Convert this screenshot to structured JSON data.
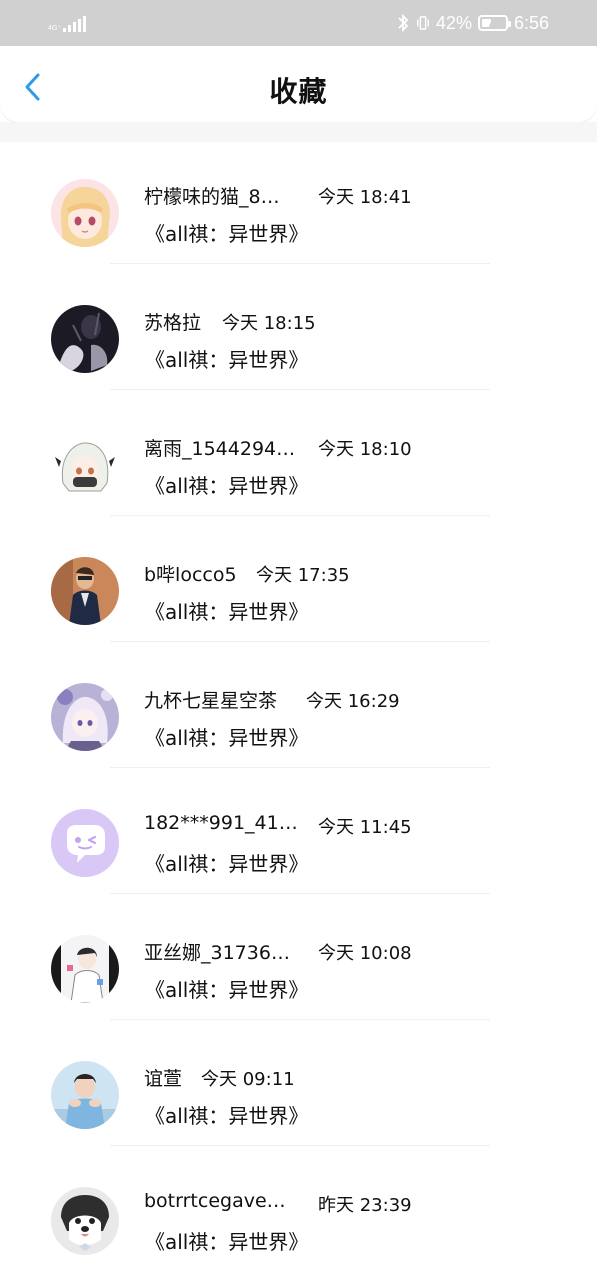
{
  "status_bar": {
    "network": "4G⁺",
    "battery": "42%",
    "battery_level": 0.42,
    "time": "6:56"
  },
  "header": {
    "title": "收藏",
    "back_icon": "chevron-left-icon"
  },
  "items": [
    {
      "name": "柠檬味的猫_8…",
      "time": "今天 18:41",
      "title": "《all祺：异世界》",
      "avatar_icon": "anime-girl-avatar-icon"
    },
    {
      "name": "苏格拉",
      "time": "今天 18:15",
      "title": "《all祺：异世界》",
      "avatar_icon": "dark-photo-avatar-icon"
    },
    {
      "name": "离雨_1544294…",
      "time": "今天 18:10",
      "title": "《all祺：异世界》",
      "avatar_icon": "white-hair-avatar-icon"
    },
    {
      "name": "b哔locco5",
      "time": "今天 17:35",
      "title": "《all祺：异世界》",
      "avatar_icon": "man-photo-avatar-icon"
    },
    {
      "name": "九杯七星星空茶",
      "time": "今天 16:29",
      "title": "《all祺：异世界》",
      "avatar_icon": "anime-avatar-icon"
    },
    {
      "name": "182***991_41…",
      "time": "今天 11:45",
      "title": "《all祺：异世界》",
      "avatar_icon": "default-chat-avatar-icon"
    },
    {
      "name": "亚丝娜_31736…",
      "time": "今天 10:08",
      "title": "《all祺：异世界》",
      "avatar_icon": "sketch-avatar-icon"
    },
    {
      "name": "谊萱",
      "time": "今天 09:11",
      "title": "《all祺：异世界》",
      "avatar_icon": "boy-photo-avatar-icon"
    },
    {
      "name": "botrrtcegave…",
      "time": "昨天 23:39",
      "title": "《all祺：异世界》",
      "avatar_icon": "dog-avatar-icon"
    }
  ]
}
